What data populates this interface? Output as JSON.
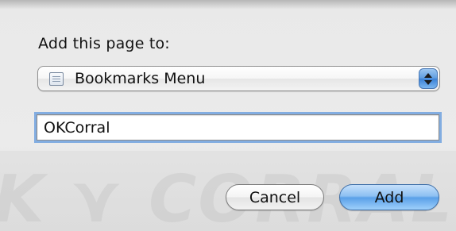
{
  "dialog": {
    "prompt_label": "Add this page to:",
    "location_popup": {
      "selected": "Bookmarks Menu",
      "icon": "bookmarks-folder-icon"
    },
    "name_field": {
      "value": "OKCorral"
    },
    "buttons": {
      "cancel_label": "Cancel",
      "add_label": "Add"
    }
  },
  "colors": {
    "accent_blue": "#5aa0e8",
    "focus_ring": "#5f98de",
    "sheet_background": "#ebebeb"
  }
}
